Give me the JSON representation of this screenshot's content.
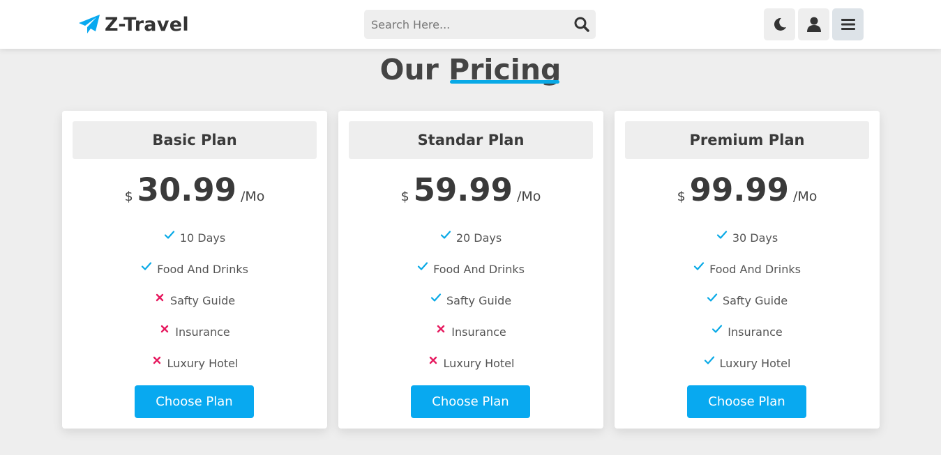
{
  "header": {
    "logo_text": "Z-Travel",
    "search_placeholder": "Search Here...",
    "icons": [
      "moon-icon",
      "user-icon",
      "menu-icon",
      "search-icon",
      "paper-plane-icon"
    ]
  },
  "heading": {
    "part1": "Our",
    "part2": "Pricing"
  },
  "colors": {
    "accent": "#08a9f0",
    "check": "#08a9e6",
    "cross": "#e6195e",
    "background": "#eeeeee"
  },
  "plans": [
    {
      "name": "Basic Plan",
      "currency": "$",
      "price": "30.99",
      "period": "/Mo",
      "features": [
        {
          "label": "10 Days",
          "included": true
        },
        {
          "label": "Food And Drinks",
          "included": true
        },
        {
          "label": "Safty Guide",
          "included": false
        },
        {
          "label": "Insurance",
          "included": false
        },
        {
          "label": "Luxury Hotel",
          "included": false
        }
      ],
      "button": "Choose Plan"
    },
    {
      "name": "Standar Plan",
      "currency": "$",
      "price": "59.99",
      "period": "/Mo",
      "features": [
        {
          "label": "20 Days",
          "included": true
        },
        {
          "label": "Food And Drinks",
          "included": true
        },
        {
          "label": "Safty Guide",
          "included": true
        },
        {
          "label": "Insurance",
          "included": false
        },
        {
          "label": "Luxury Hotel",
          "included": false
        }
      ],
      "button": "Choose Plan"
    },
    {
      "name": "Premium Plan",
      "currency": "$",
      "price": "99.99",
      "period": "/Mo",
      "features": [
        {
          "label": "30 Days",
          "included": true
        },
        {
          "label": "Food And Drinks",
          "included": true
        },
        {
          "label": "Safty Guide",
          "included": true
        },
        {
          "label": "Insurance",
          "included": true
        },
        {
          "label": "Luxury Hotel",
          "included": true
        }
      ],
      "button": "Choose Plan"
    }
  ]
}
